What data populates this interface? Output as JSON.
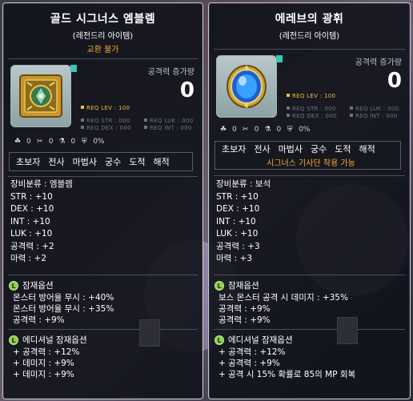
{
  "tooltips": [
    {
      "title": "골드 시그너스 엠블렘",
      "rarity": "(레전드리 아이템)",
      "trade": "교환 불가",
      "attack_increase_label": "공격력 증가량",
      "attack_increase_value": "0",
      "req": {
        "lev": "REQ LEV : 100",
        "str": "REQ STR : 000",
        "luk": "REQ LUK : 000",
        "dex": "REQ DEX : 000",
        "int": "REQ INT : 000"
      },
      "status": [
        "0",
        "0",
        "0",
        "0%"
      ],
      "jobs": [
        "초보자",
        "전사",
        "마법사",
        "궁수",
        "도적",
        "해적"
      ],
      "jobs_note": "",
      "stats": [
        "장비분류 : 엠블렘",
        "STR : +10",
        "DEX : +10",
        "INT : +10",
        "LUK : +10",
        "공격력 : +2",
        "마력 : +2"
      ],
      "potential_title": "잠재옵션",
      "potential_badge": "L",
      "potential": [
        "몬스터 방어율 무시 : +40%",
        "몬스터 방어율 무시 : +35%",
        "공격력 : +9%"
      ],
      "additional_title": "에디셔널 잠재옵션",
      "additional_badge": "L",
      "additional": [
        "+ 공격력 : +12%",
        "+ 데미지 : +9%",
        "+ 데미지 : +9%"
      ]
    },
    {
      "title": "에레브의 광휘",
      "rarity": "(레전드리 아이템)",
      "trade": "",
      "attack_increase_label": "공격력 증가량",
      "attack_increase_value": "0",
      "req": {
        "lev": "REQ LEV : 100",
        "str": "REQ STR : 000",
        "luk": "REQ LUK : 000",
        "dex": "REQ DEX : 000",
        "int": "REQ INT : 000"
      },
      "status": [
        "0",
        "0",
        "0",
        "0%"
      ],
      "jobs": [
        "초보자",
        "전사",
        "마법사",
        "궁수",
        "도적",
        "해적"
      ],
      "jobs_note": "시그너스 기사단 착용 가능",
      "stats": [
        "장비분류 : 보석",
        "STR : +10",
        "DEX : +10",
        "INT : +10",
        "LUK : +10",
        "공격력 : +3",
        "마력 : +3"
      ],
      "potential_title": "잠재옵션",
      "potential_badge": "L",
      "potential": [
        "보스 몬스터 공격 시 데미지 : +35%",
        "공격력 : +9%",
        "공격력 : +9%"
      ],
      "additional_title": "에디셔널 잠재옵션",
      "additional_badge": "L",
      "additional": [
        "+ 공격력 : +12%",
        "+ 공격력 : +9%",
        "+ 공격 시 15% 확률로 85의 MP 회복"
      ]
    }
  ],
  "colors": {
    "trade": "#ffaa33",
    "req_lev": "#f0c040",
    "req_other": "#6f737e",
    "badge": "#8fd04a",
    "frame": "#c6c9d2"
  }
}
